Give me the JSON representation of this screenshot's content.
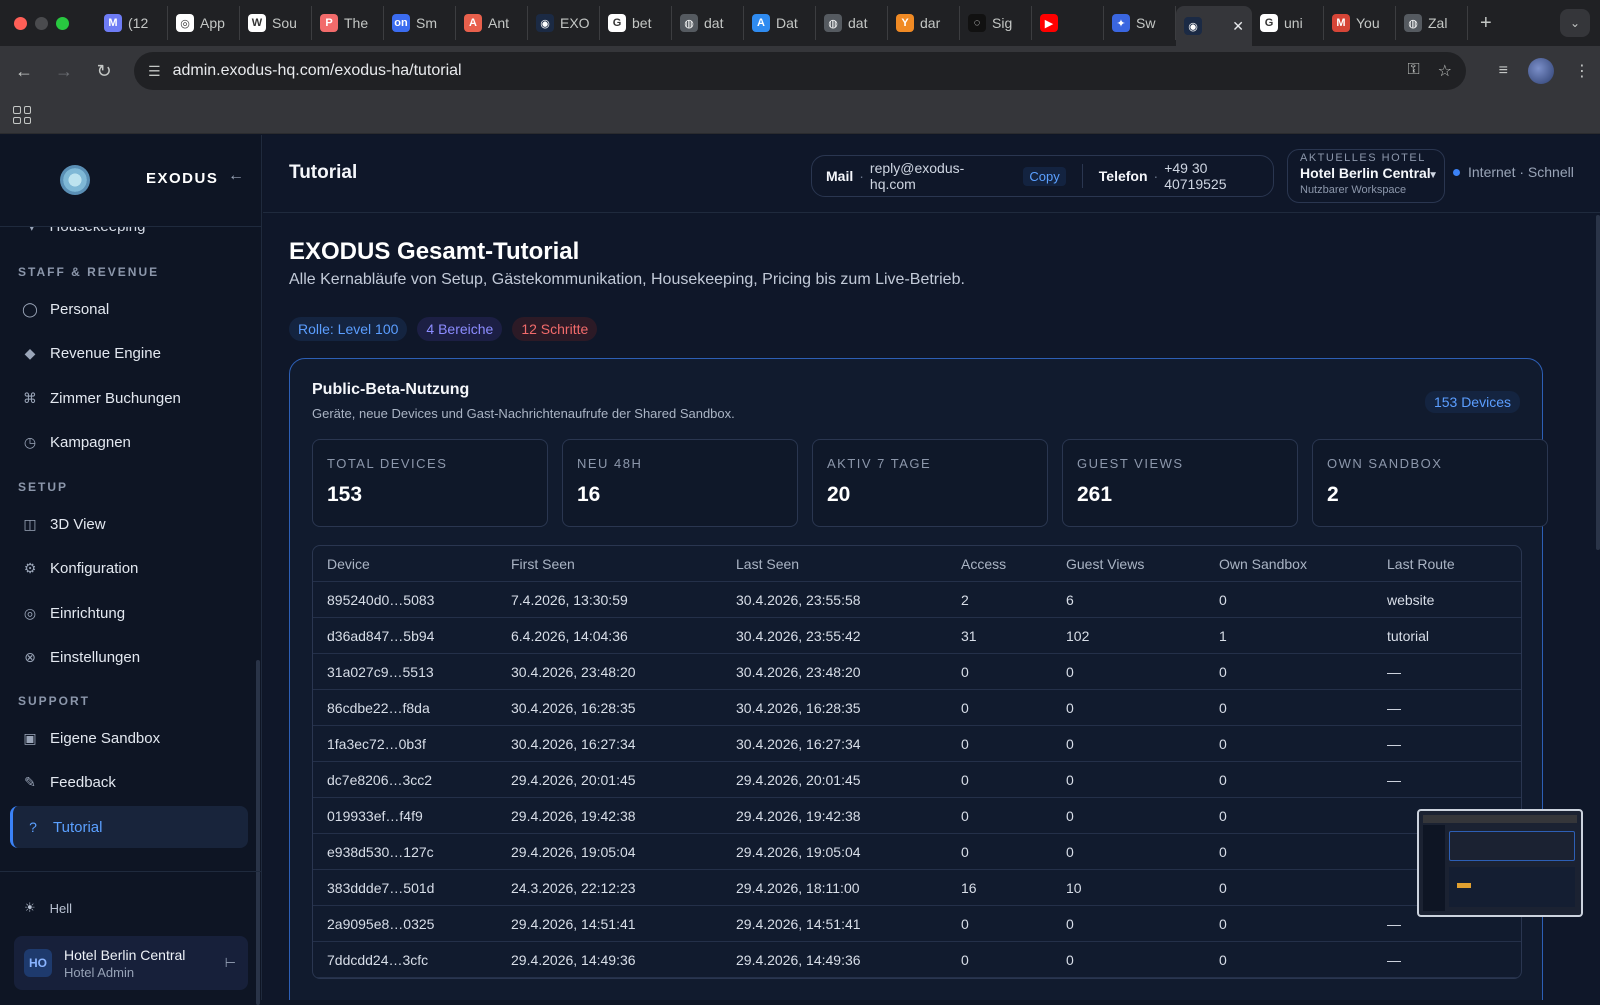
{
  "browser": {
    "tabs": [
      {
        "label": "(12",
        "fav": "M",
        "color": "#6e7cf5"
      },
      {
        "label": "App",
        "fav": "◎",
        "color": "#ffffff"
      },
      {
        "label": "Sou",
        "fav": "W",
        "color": "#ffffff"
      },
      {
        "label": "The",
        "fav": "P",
        "color": "#f26b6b"
      },
      {
        "label": "Sm",
        "fav": "on",
        "color": "#3b6cf0"
      },
      {
        "label": "Ant",
        "fav": "A",
        "color": "#e8604c"
      },
      {
        "label": "EXO",
        "fav": "◉",
        "color": "#1b2a44"
      },
      {
        "label": "bet",
        "fav": "G",
        "color": "#ffffff"
      },
      {
        "label": "dat",
        "fav": "◍",
        "color": "#555a60"
      },
      {
        "label": "Dat",
        "fav": "A",
        "color": "#2f8bf0"
      },
      {
        "label": "dat",
        "fav": "◍",
        "color": "#555a60"
      },
      {
        "label": "dar",
        "fav": "Y",
        "color": "#f08a24"
      },
      {
        "label": "Sig",
        "fav": "◌",
        "color": "#111111"
      },
      {
        "label": "",
        "fav": "▶",
        "color": "#ff0000"
      },
      {
        "label": "Sw",
        "fav": "✦",
        "color": "#3a66e0"
      }
    ],
    "active_tab": {
      "label": "",
      "fav": "◉",
      "color": "#1b2a44"
    },
    "tabs_after": [
      {
        "label": "uni",
        "fav": "G",
        "color": "#ffffff"
      },
      {
        "label": "You",
        "fav": "M",
        "color": "#d64537"
      },
      {
        "label": "Zal",
        "fav": "◍",
        "color": "#555a60"
      }
    ],
    "url": "admin.exodus-hq.com/exodus-ha/tutorial"
  },
  "sidebar": {
    "brand": "EXODUS",
    "partial_item": "Housekeeping",
    "sections": [
      {
        "title": "STAFF & REVENUE",
        "items": [
          {
            "label": "Personal",
            "icon": "person-circle-icon",
            "glyph": "◯"
          },
          {
            "label": "Revenue Engine",
            "icon": "diamond-icon",
            "glyph": "◆"
          },
          {
            "label": "Zimmer Buchungen",
            "icon": "command-icon",
            "glyph": "⌘"
          },
          {
            "label": "Kampagnen",
            "icon": "clock-icon",
            "glyph": "◷"
          }
        ]
      },
      {
        "title": "SETUP",
        "items": [
          {
            "label": "3D View",
            "icon": "columns-icon",
            "glyph": "◫"
          },
          {
            "label": "Konfiguration",
            "icon": "gear-icon",
            "glyph": "⚙"
          },
          {
            "label": "Einrichtung",
            "icon": "target-icon",
            "glyph": "◎"
          },
          {
            "label": "Einstellungen",
            "icon": "circle-x-icon",
            "glyph": "⊗"
          }
        ]
      },
      {
        "title": "SUPPORT",
        "items": [
          {
            "label": "Eigene Sandbox",
            "icon": "square-icon",
            "glyph": "▣"
          },
          {
            "label": "Feedback",
            "icon": "pencil-icon",
            "glyph": "✎"
          },
          {
            "label": "Tutorial",
            "icon": "question-icon",
            "glyph": "?"
          }
        ]
      }
    ],
    "theme_label": "Hell",
    "user": {
      "initials": "HO",
      "name": "Hotel Berlin Central",
      "role": "Hotel Admin"
    }
  },
  "header": {
    "title": "Tutorial",
    "mail_label": "Mail",
    "mail_value": "reply@exodus-hq.com",
    "copy_label": "Copy",
    "phone_label": "Telefon",
    "phone_value": "+49 30 40719525",
    "hotel_label": "AKTUELLES HOTEL",
    "hotel_name": "Hotel Berlin Central",
    "hotel_sub": "Nutzbarer Workspace",
    "net_status": "Internet · Schnell"
  },
  "tutorial": {
    "title": "EXODUS Gesamt-Tutorial",
    "subtitle": "Alle Kernabläufe von Setup, Gästekommunikation, Housekeeping, Pricing bis zum Live-Betrieb.",
    "chips": [
      "Rolle: Level 100",
      "4 Bereiche",
      "12 Schritte"
    ]
  },
  "beta": {
    "title": "Public-Beta-Nutzung",
    "subtitle": "Geräte, neue Devices und Gast-Nachrichtenaufrufe der Shared Sandbox.",
    "badge": "153 Devices",
    "stats": [
      {
        "key": "TOTAL DEVICES",
        "value": "153"
      },
      {
        "key": "NEU 48H",
        "value": "16"
      },
      {
        "key": "AKTIV 7 TAGE",
        "value": "20"
      },
      {
        "key": "GUEST VIEWS",
        "value": "261"
      },
      {
        "key": "OWN SANDBOX",
        "value": "2"
      }
    ],
    "columns": [
      "Device",
      "First Seen",
      "Last Seen",
      "Access",
      "Guest Views",
      "Own Sandbox",
      "Last Route"
    ],
    "rows": [
      [
        "895240d0…5083",
        "7.4.2026, 13:30:59",
        "30.4.2026, 23:55:58",
        "2",
        "6",
        "0",
        "website"
      ],
      [
        "d36ad847…5b94",
        "6.4.2026, 14:04:36",
        "30.4.2026, 23:55:42",
        "31",
        "102",
        "1",
        "tutorial"
      ],
      [
        "31a027c9…5513",
        "30.4.2026, 23:48:20",
        "30.4.2026, 23:48:20",
        "0",
        "0",
        "0",
        "—"
      ],
      [
        "86cdbe22…f8da",
        "30.4.2026, 16:28:35",
        "30.4.2026, 16:28:35",
        "0",
        "0",
        "0",
        "—"
      ],
      [
        "1fa3ec72…0b3f",
        "30.4.2026, 16:27:34",
        "30.4.2026, 16:27:34",
        "0",
        "0",
        "0",
        "—"
      ],
      [
        "dc7e8206…3cc2",
        "29.4.2026, 20:01:45",
        "29.4.2026, 20:01:45",
        "0",
        "0",
        "0",
        "—"
      ],
      [
        "019933ef…f4f9",
        "29.4.2026, 19:42:38",
        "29.4.2026, 19:42:38",
        "0",
        "0",
        "0",
        ""
      ],
      [
        "e938d530…127c",
        "29.4.2026, 19:05:04",
        "29.4.2026, 19:05:04",
        "0",
        "0",
        "0",
        ""
      ],
      [
        "383ddde7…501d",
        "24.3.2026, 22:12:23",
        "29.4.2026, 18:11:00",
        "16",
        "10",
        "0",
        ""
      ],
      [
        "2a9095e8…0325",
        "29.4.2026, 14:51:41",
        "29.4.2026, 14:51:41",
        "0",
        "0",
        "0",
        "—"
      ],
      [
        "7ddcdd24…3cfc",
        "29.4.2026, 14:49:36",
        "29.4.2026, 14:49:36",
        "0",
        "0",
        "0",
        "—"
      ]
    ]
  }
}
